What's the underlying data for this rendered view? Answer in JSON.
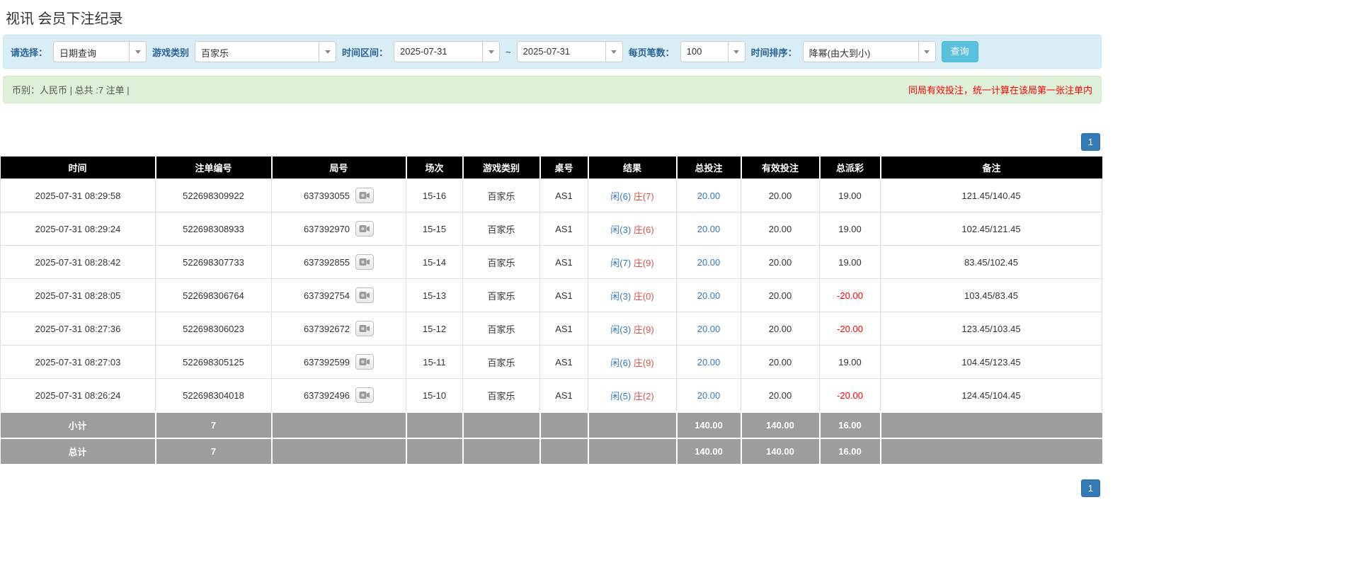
{
  "page": {
    "title": "视讯 会员下注纪录"
  },
  "filters": {
    "select_label": "请选择：",
    "select_value": "日期查询",
    "game_type_label": "游戏类别",
    "game_type_value": "百家乐",
    "date_range_label": "时间区间：",
    "date_from": "2025-07-31",
    "tilde": "~",
    "date_to": "2025-07-31",
    "page_size_label": "每页笔数：",
    "page_size_value": "100",
    "sort_label": "时间排序：",
    "sort_value": "降幂(由大到小)",
    "search_button": "查询"
  },
  "summary": {
    "left": "币别：人民币 | 总共 :7 注单 |",
    "right": "同局有效投注，统一计算在该局第一张注单内"
  },
  "pagination": {
    "page": "1"
  },
  "table": {
    "headers": [
      "时间",
      "注单编号",
      "局号",
      "场次",
      "游戏类别",
      "桌号",
      "结果",
      "总投注",
      "有效投注",
      "总派彩",
      "备注"
    ],
    "rows": [
      {
        "time": "2025-07-31 08:29:58",
        "bet_no": "522698309922",
        "round_no": "637393055",
        "session": "15-16",
        "game": "百家乐",
        "table_no": "AS1",
        "result_player": "闲(6)",
        "result_banker": "庄(7)",
        "total_bet": "20.00",
        "valid_bet": "20.00",
        "payout": "19.00",
        "note": "121.45/140.45"
      },
      {
        "time": "2025-07-31 08:29:24",
        "bet_no": "522698308933",
        "round_no": "637392970",
        "session": "15-15",
        "game": "百家乐",
        "table_no": "AS1",
        "result_player": "闲(3)",
        "result_banker": "庄(6)",
        "total_bet": "20.00",
        "valid_bet": "20.00",
        "payout": "19.00",
        "note": "102.45/121.45"
      },
      {
        "time": "2025-07-31 08:28:42",
        "bet_no": "522698307733",
        "round_no": "637392855",
        "session": "15-14",
        "game": "百家乐",
        "table_no": "AS1",
        "result_player": "闲(7)",
        "result_banker": "庄(9)",
        "total_bet": "20.00",
        "valid_bet": "20.00",
        "payout": "19.00",
        "note": "83.45/102.45"
      },
      {
        "time": "2025-07-31 08:28:05",
        "bet_no": "522698306764",
        "round_no": "637392754",
        "session": "15-13",
        "game": "百家乐",
        "table_no": "AS1",
        "result_player": "闲(3)",
        "result_banker": "庄(0)",
        "total_bet": "20.00",
        "valid_bet": "20.00",
        "payout": "-20.00",
        "note": "103.45/83.45"
      },
      {
        "time": "2025-07-31 08:27:36",
        "bet_no": "522698306023",
        "round_no": "637392672",
        "session": "15-12",
        "game": "百家乐",
        "table_no": "AS1",
        "result_player": "闲(3)",
        "result_banker": "庄(9)",
        "total_bet": "20.00",
        "valid_bet": "20.00",
        "payout": "-20.00",
        "note": "123.45/103.45"
      },
      {
        "time": "2025-07-31 08:27:03",
        "bet_no": "522698305125",
        "round_no": "637392599",
        "session": "15-11",
        "game": "百家乐",
        "table_no": "AS1",
        "result_player": "闲(6)",
        "result_banker": "庄(9)",
        "total_bet": "20.00",
        "valid_bet": "20.00",
        "payout": "19.00",
        "note": "104.45/123.45"
      },
      {
        "time": "2025-07-31 08:26:24",
        "bet_no": "522698304018",
        "round_no": "637392496",
        "session": "15-10",
        "game": "百家乐",
        "table_no": "AS1",
        "result_player": "闲(5)",
        "result_banker": "庄(2)",
        "total_bet": "20.00",
        "valid_bet": "20.00",
        "payout": "-20.00",
        "note": "124.45/104.45"
      }
    ],
    "subtotal": {
      "label": "小计",
      "count": "7",
      "total_bet": "140.00",
      "valid_bet": "140.00",
      "payout": "16.00"
    },
    "total": {
      "label": "总计",
      "count": "7",
      "total_bet": "140.00",
      "valid_bet": "140.00",
      "payout": "16.00"
    }
  }
}
